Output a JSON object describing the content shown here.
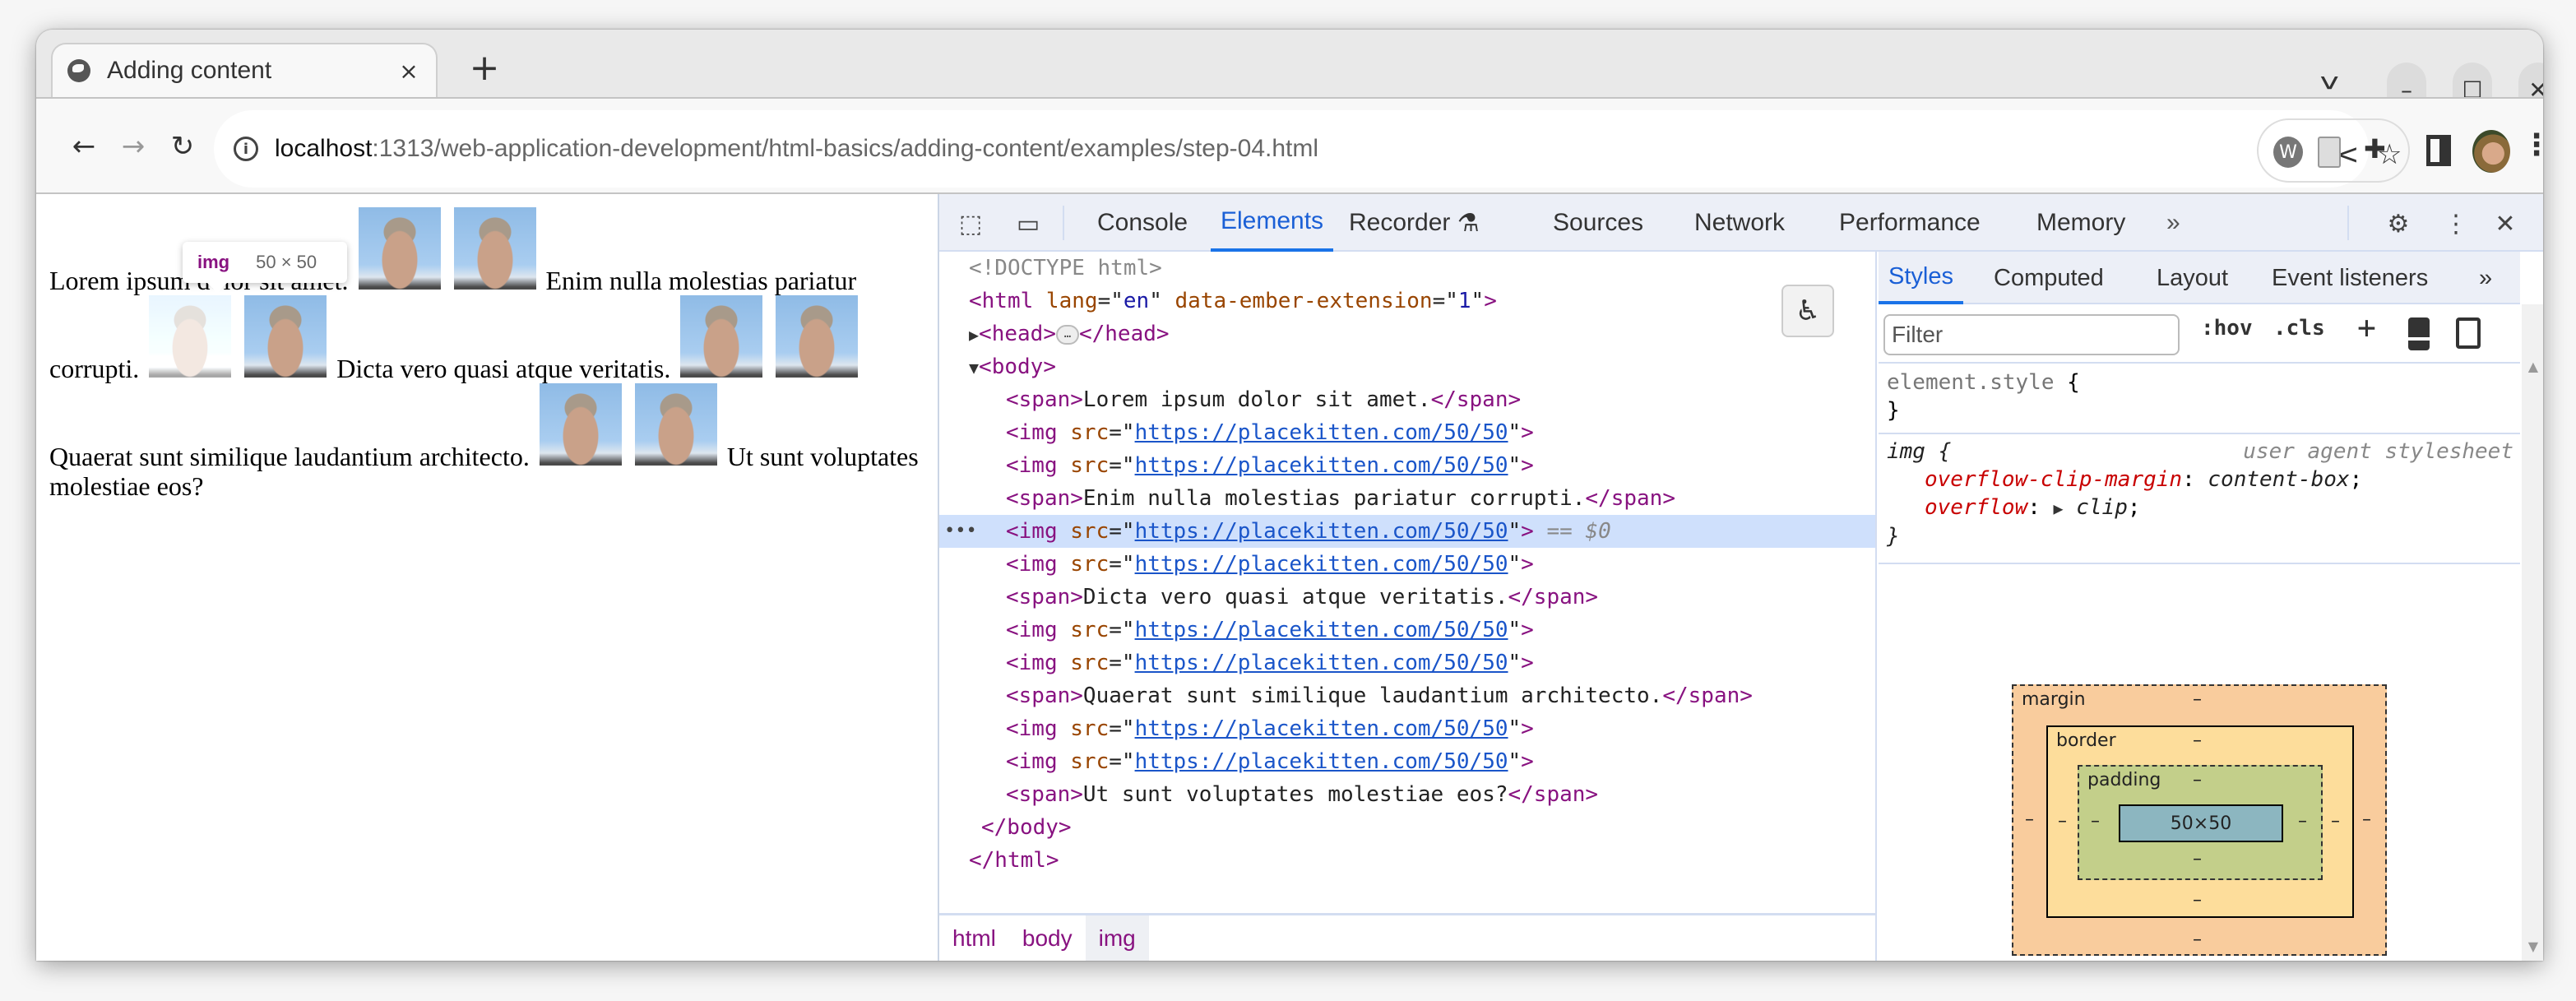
{
  "browser": {
    "tab": {
      "title": "Adding content",
      "favicon": "globe-icon",
      "close_glyph": "×"
    },
    "new_tab_glyph": "+",
    "tab_search_glyph": "⌄",
    "window_controls": {
      "minimize": "–",
      "maximize": "☐",
      "close": "✕"
    },
    "nav": {
      "back": "←",
      "forward": "→",
      "reload": "↻"
    },
    "omnibox": {
      "info_glyph": "i",
      "host": "localhost",
      "path": ":1313/web-application-development/html-basics/adding-content/examples/step-04.html"
    },
    "toolbar_icons": {
      "share": "⋖",
      "bookmark": "☆",
      "extension_w": "W",
      "puzzle": "✚",
      "menu": "⋮"
    }
  },
  "page": {
    "segments": [
      {
        "type": "text",
        "value": "Lorem ipsum dolor sit amet."
      },
      {
        "type": "img"
      },
      {
        "type": "img"
      },
      {
        "type": "text",
        "value": "Enim nulla molestias pariatur corrupti."
      },
      {
        "type": "img",
        "selected": true
      },
      {
        "type": "img"
      },
      {
        "type": "text",
        "value": "Dicta vero quasi atque veritatis."
      },
      {
        "type": "img"
      },
      {
        "type": "img"
      },
      {
        "type": "text",
        "value": "Quaerat sunt similique laudantium architecto."
      },
      {
        "type": "img"
      },
      {
        "type": "img"
      },
      {
        "type": "text",
        "value": "Ut sunt voluptates molestiae eos?"
      }
    ],
    "tooltip": {
      "tag": "img",
      "dims": "50 × 50"
    }
  },
  "devtools": {
    "tabs": [
      "Console",
      "Elements",
      "Recorder",
      "Sources",
      "Network",
      "Performance",
      "Memory"
    ],
    "active_tab": "Elements",
    "more_tabs_glyph": "»",
    "icons": {
      "settings": "⚙",
      "menu": "⋮",
      "close": "✕"
    },
    "dom": {
      "doctype": "<!DOCTYPE html>",
      "html_open": {
        "tag": "html",
        "attrs": [
          {
            "name": "lang",
            "value": "en"
          },
          {
            "name": "data-ember-extension",
            "value": "1"
          }
        ]
      },
      "head": "head",
      "body": "body",
      "children": [
        {
          "kind": "span",
          "text": "Lorem ipsum dolor sit amet."
        },
        {
          "kind": "img",
          "src": "https://placekitten.com/50/50"
        },
        {
          "kind": "img",
          "src": "https://placekitten.com/50/50"
        },
        {
          "kind": "span",
          "text": "Enim nulla molestias pariatur corrupti."
        },
        {
          "kind": "img",
          "src": "https://placekitten.com/50/50",
          "selected": true
        },
        {
          "kind": "img",
          "src": "https://placekitten.com/50/50"
        },
        {
          "kind": "span",
          "text": "Dicta vero quasi atque veritatis."
        },
        {
          "kind": "img",
          "src": "https://placekitten.com/50/50"
        },
        {
          "kind": "img",
          "src": "https://placekitten.com/50/50"
        },
        {
          "kind": "span",
          "text": "Quaerat sunt similique laudantium architecto."
        },
        {
          "kind": "img",
          "src": "https://placekitten.com/50/50"
        },
        {
          "kind": "img",
          "src": "https://placekitten.com/50/50"
        },
        {
          "kind": "span",
          "text": "Ut sunt voluptates molestiae eos?"
        }
      ],
      "selected_marker": "== $0"
    },
    "breadcrumbs": [
      "html",
      "body",
      "img"
    ],
    "active_breadcrumb": "img",
    "styles": {
      "tabs": [
        "Styles",
        "Computed",
        "Layout",
        "Event listeners"
      ],
      "active_tab": "Styles",
      "filter_placeholder": "Filter",
      "hov_label": ":hov",
      "cls_label": ".cls",
      "rules": [
        {
          "selector": "element.style",
          "origin": "",
          "props": []
        },
        {
          "selector": "img",
          "origin": "user agent stylesheet",
          "props": [
            {
              "name": "overflow-clip-margin",
              "value": "content-box"
            },
            {
              "name": "overflow",
              "value": "clip"
            }
          ]
        }
      ],
      "box_model": {
        "margin_label": "margin",
        "border_label": "border",
        "padding_label": "padding",
        "content": "50×50",
        "empty": "–"
      }
    }
  },
  "colors": {
    "accent": "#1a73e8",
    "tag": "#881280",
    "attr_name": "#994500",
    "attr_value": "#1a1aa6",
    "selected_row": "#cfe0fc",
    "bm_margin": "#f9cc9d",
    "bm_border": "#fddd9b",
    "bm_padding": "#c3cf8a",
    "bm_content": "#8cb6c0"
  }
}
